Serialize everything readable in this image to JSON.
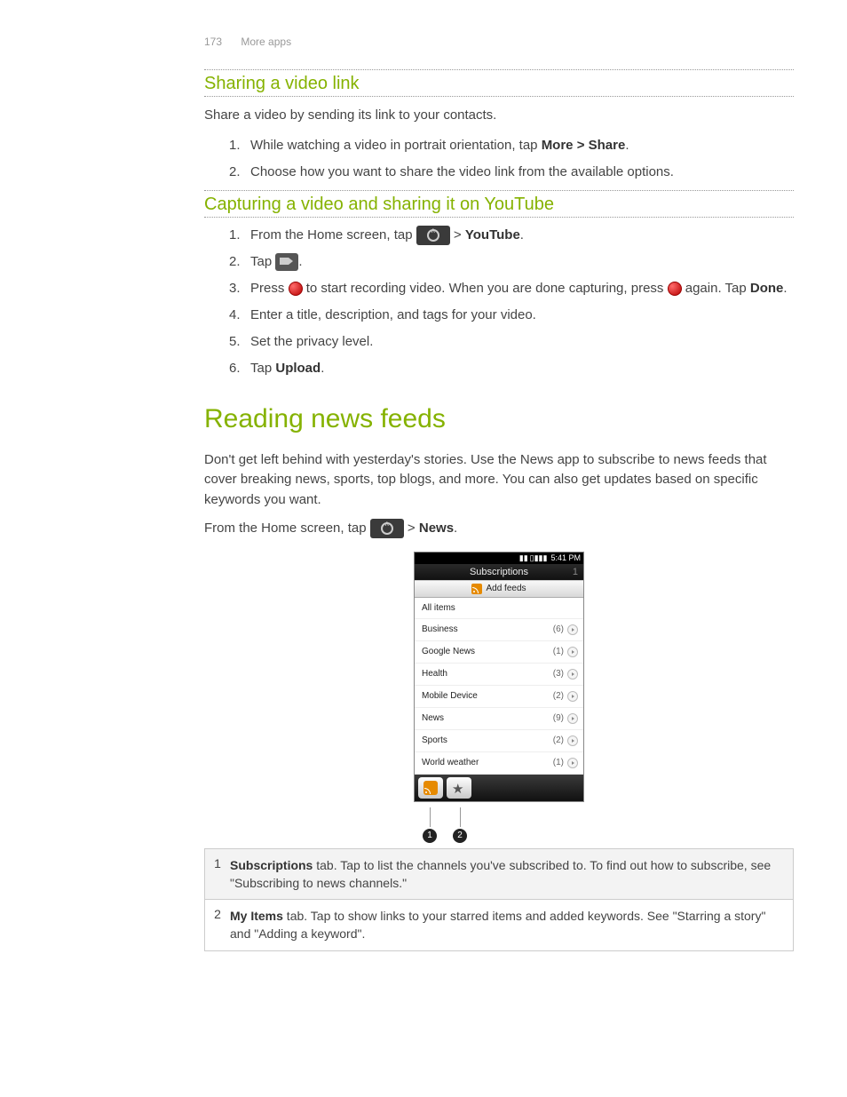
{
  "header": {
    "page_number": "173",
    "section": "More apps"
  },
  "sec1": {
    "title": "Sharing a video link",
    "intro": "Share a video by sending its link to your contacts.",
    "steps": [
      {
        "pre": "While watching a video in portrait orientation, tap ",
        "bold": "More > Share",
        "post": "."
      },
      {
        "pre": "Choose how you want to share the video link from the available options.",
        "bold": "",
        "post": ""
      }
    ]
  },
  "sec2": {
    "title": "Capturing a video and sharing it on YouTube",
    "step1_pre": "From the Home screen, tap ",
    "step1_post": " > ",
    "step1_bold": "YouTube",
    "step1_end": ".",
    "step2_pre": "Tap ",
    "step2_post": ".",
    "step3_pre": "Press ",
    "step3_mid": " to start recording video. When you are done capturing, press ",
    "step3_post": " again. Tap ",
    "step3_bold": "Done",
    "step3_end": ".",
    "step4": "Enter a title, description, and tags for your video.",
    "step5": "Set the privacy level.",
    "step6_pre": "Tap ",
    "step6_bold": "Upload",
    "step6_end": "."
  },
  "sec3": {
    "title": "Reading news feeds",
    "intro": "Don't get left behind with yesterday's stories. Use the News app to subscribe to news feeds that cover breaking news, sports, top blogs, and more. You can also get updates based on specific keywords you want.",
    "open_pre": "From the Home screen, tap ",
    "open_post": " > ",
    "open_bold": "News",
    "open_end": "."
  },
  "phone": {
    "time": "5:41 PM",
    "title": "Subscriptions",
    "title_count": "1",
    "add_label": "Add feeds",
    "header_row": "All items",
    "feeds": [
      {
        "name": "Business",
        "count": "(6)"
      },
      {
        "name": "Google News",
        "count": "(1)"
      },
      {
        "name": "Health",
        "count": "(3)"
      },
      {
        "name": "Mobile Device",
        "count": "(2)"
      },
      {
        "name": "News",
        "count": "(9)"
      },
      {
        "name": "Sports",
        "count": "(2)"
      },
      {
        "name": "World weather",
        "count": "(1)"
      }
    ]
  },
  "callouts": {
    "n1": "1",
    "n2": "2"
  },
  "legend": [
    {
      "idx": "1",
      "bold": "Subscriptions",
      "rest": " tab. Tap to list the channels you've subscribed to. To find out how to subscribe, see \"Subscribing to news channels.\""
    },
    {
      "idx": "2",
      "bold": "My Items",
      "rest": " tab. Tap to show links to your starred items and added keywords. See \"Starring a story\" and \"Adding a keyword\"."
    }
  ]
}
